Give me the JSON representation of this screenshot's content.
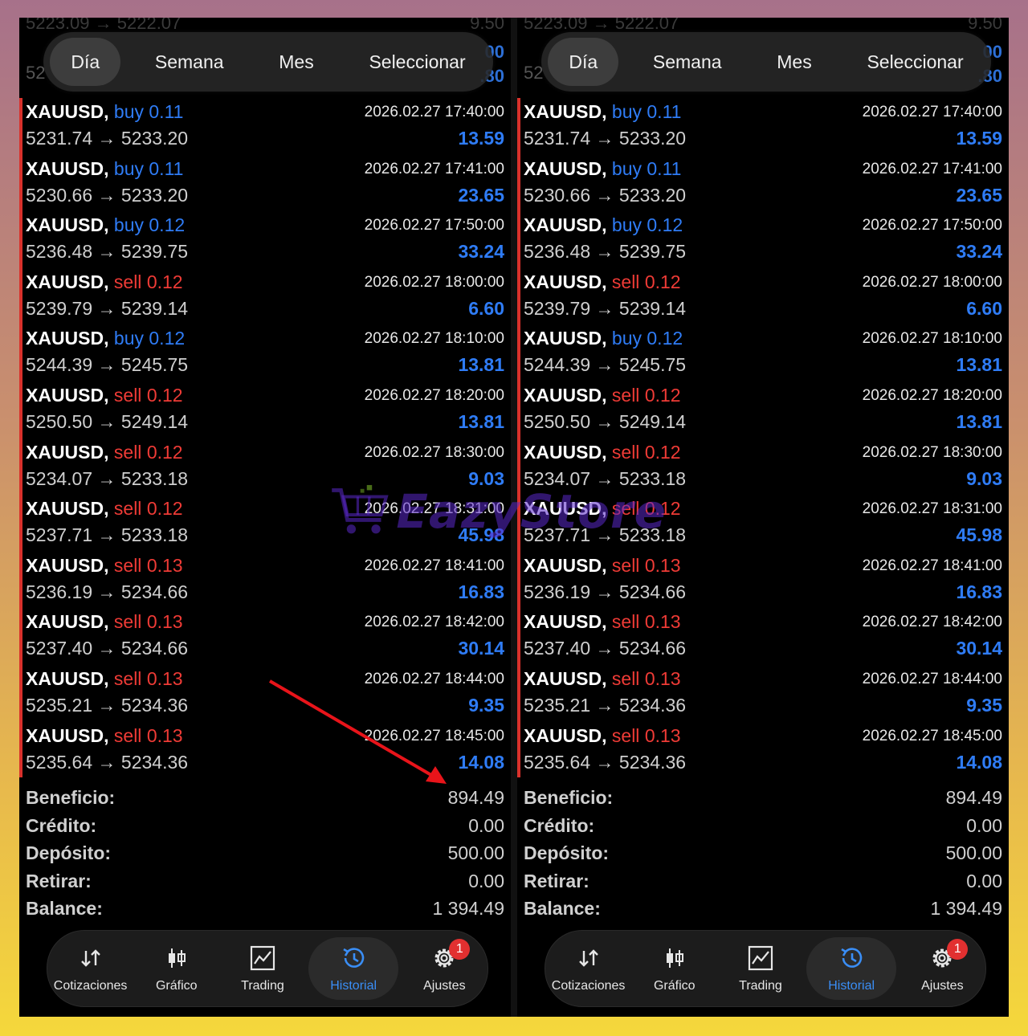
{
  "period_tabs": [
    "Día",
    "Semana",
    "Mes",
    "Seleccionar"
  ],
  "active_period": "Día",
  "ghost_rows": {
    "top_left": "5223.09 → 5222.07",
    "top_right": "9.50",
    "second_left": "52",
    "second_right": "00",
    "third_right": ".80"
  },
  "trades": [
    {
      "symbol": "XAUUSD,",
      "side": "buy",
      "volume": "0.11",
      "datetime": "2026.02.27 17:40:00",
      "prices": "5231.74 → 5233.20",
      "profit": "13.59"
    },
    {
      "symbol": "XAUUSD,",
      "side": "buy",
      "volume": "0.11",
      "datetime": "2026.02.27 17:41:00",
      "prices": "5230.66 → 5233.20",
      "profit": "23.65"
    },
    {
      "symbol": "XAUUSD,",
      "side": "buy",
      "volume": "0.12",
      "datetime": "2026.02.27 17:50:00",
      "prices": "5236.48 → 5239.75",
      "profit": "33.24"
    },
    {
      "symbol": "XAUUSD,",
      "side": "sell",
      "volume": "0.12",
      "datetime": "2026.02.27 18:00:00",
      "prices": "5239.79 → 5239.14",
      "profit": "6.60"
    },
    {
      "symbol": "XAUUSD,",
      "side": "buy",
      "volume": "0.12",
      "datetime": "2026.02.27 18:10:00",
      "prices": "5244.39 → 5245.75",
      "profit": "13.81"
    },
    {
      "symbol": "XAUUSD,",
      "side": "sell",
      "volume": "0.12",
      "datetime": "2026.02.27 18:20:00",
      "prices": "5250.50 → 5249.14",
      "profit": "13.81"
    },
    {
      "symbol": "XAUUSD,",
      "side": "sell",
      "volume": "0.12",
      "datetime": "2026.02.27 18:30:00",
      "prices": "5234.07 → 5233.18",
      "profit": "9.03"
    },
    {
      "symbol": "XAUUSD,",
      "side": "sell",
      "volume": "0.12",
      "datetime": "2026.02.27 18:31:00",
      "prices": "5237.71 → 5233.18",
      "profit": "45.98"
    },
    {
      "symbol": "XAUUSD,",
      "side": "sell",
      "volume": "0.13",
      "datetime": "2026.02.27 18:41:00",
      "prices": "5236.19 → 5234.66",
      "profit": "16.83"
    },
    {
      "symbol": "XAUUSD,",
      "side": "sell",
      "volume": "0.13",
      "datetime": "2026.02.27 18:42:00",
      "prices": "5237.40 → 5234.66",
      "profit": "30.14"
    },
    {
      "symbol": "XAUUSD,",
      "side": "sell",
      "volume": "0.13",
      "datetime": "2026.02.27 18:44:00",
      "prices": "5235.21 → 5234.36",
      "profit": "9.35"
    },
    {
      "symbol": "XAUUSD,",
      "side": "sell",
      "volume": "0.13",
      "datetime": "2026.02.27 18:45:00",
      "prices": "5235.64 → 5234.36",
      "profit": "14.08"
    }
  ],
  "summary": [
    {
      "label": "Beneficio:",
      "value": "894.49"
    },
    {
      "label": "Crédito:",
      "value": "0.00"
    },
    {
      "label": "Depósito:",
      "value": "500.00"
    },
    {
      "label": "Retirar:",
      "value": "0.00"
    },
    {
      "label": "Balance:",
      "value": "1 394.49"
    }
  ],
  "nav": [
    {
      "label": "Cotizaciones",
      "icon": "quotes-arrows-icon"
    },
    {
      "label": "Gráfico",
      "icon": "candlestick-chart-icon"
    },
    {
      "label": "Trading",
      "icon": "trading-chart-icon"
    },
    {
      "label": "Historial",
      "icon": "history-clock-icon"
    },
    {
      "label": "Ajustes",
      "icon": "settings-gear-icon"
    }
  ],
  "active_nav": "Historial",
  "settings_badge": "1",
  "watermark": "EazyStore",
  "colors": {
    "buy": "#2f7cf6",
    "sell": "#ef3b36",
    "profit": "#2f7cf6",
    "active_nav": "#3a8ef6",
    "annotation_arrow": "#e8141a"
  }
}
